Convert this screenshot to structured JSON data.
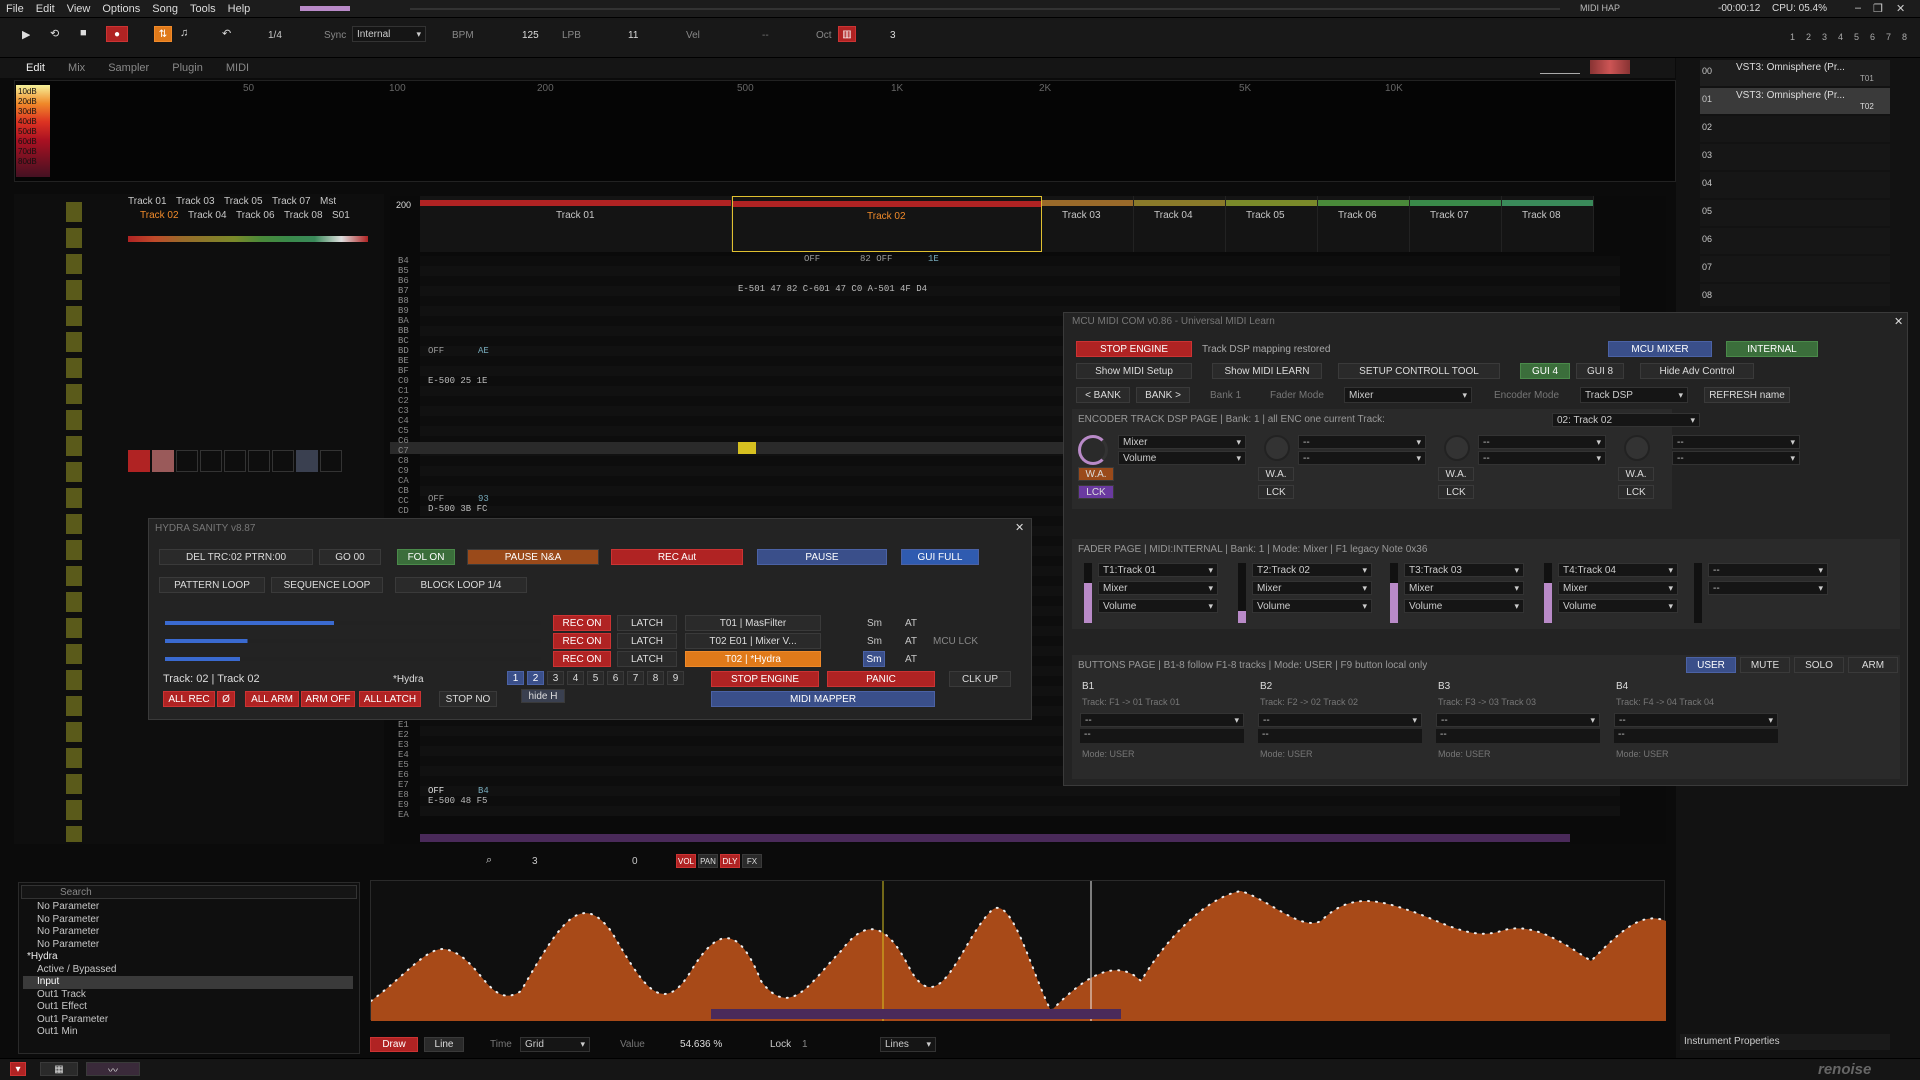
{
  "menu": [
    "File",
    "Edit",
    "View",
    "Options",
    "Song",
    "Tools",
    "Help"
  ],
  "status": {
    "midi": "MIDI HAP",
    "time": "-00:00:12",
    "cpu": "CPU: 05.4%"
  },
  "transport": {
    "step": "1/4",
    "sync_label": "Sync",
    "sync_value": "Internal",
    "bpm_label": "BPM",
    "bpm": "125",
    "lpb_label": "LPB",
    "lpb": "11",
    "vel_label": "Vel",
    "vel_value": "--",
    "oct_label": "Oct",
    "oct": "3",
    "track_nums": [
      "1",
      "2",
      "3",
      "4",
      "5",
      "6",
      "7",
      "8"
    ]
  },
  "tabs": [
    "Edit",
    "Mix",
    "Sampler",
    "Plugin",
    "MIDI"
  ],
  "spectrum": {
    "freqs": [
      "50",
      "100",
      "200",
      "500",
      "1K",
      "2K",
      "5K",
      "10K"
    ],
    "scale": [
      "10dB",
      "20dB",
      "30dB",
      "40dB",
      "50dB",
      "60dB",
      "70dB",
      "80dB"
    ]
  },
  "instruments": {
    "rows": [
      {
        "num": "00",
        "name": "VST3: Omnisphere (Pr...",
        "tag": "T01"
      },
      {
        "num": "01",
        "name": "VST3: Omnisphere (Pr...",
        "tag": "T02"
      },
      {
        "num": "02"
      },
      {
        "num": "03"
      },
      {
        "num": "04"
      },
      {
        "num": "05"
      },
      {
        "num": "06"
      },
      {
        "num": "07"
      },
      {
        "num": "08"
      }
    ]
  },
  "mixer_tracks": {
    "row1": [
      "Track 01",
      "Track 03",
      "Track 05",
      "Track 07",
      "Mst"
    ],
    "row2": [
      "Track 02",
      "Track 04",
      "Track 06",
      "Track 08",
      "S01"
    ]
  },
  "pattern": {
    "num": "200",
    "tracks": [
      {
        "name": "Track 01",
        "color": "#b02323"
      },
      {
        "name": "Track 02",
        "color": "#b02323"
      },
      {
        "name": "Track 03",
        "color": "#9a6a2a"
      },
      {
        "name": "Track 04",
        "color": "#8a7a2a"
      },
      {
        "name": "Track 05",
        "color": "#7a8a2a"
      },
      {
        "name": "Track 06",
        "color": "#4a8a3a"
      },
      {
        "name": "Track 07",
        "color": "#3a8a4a"
      },
      {
        "name": "Track 08",
        "color": "#3a8a5a"
      }
    ],
    "notes_left": [
      "B4",
      "B5",
      "B6",
      "B7",
      "B8",
      "B9",
      "BA",
      "BB",
      "BC",
      "BD",
      "BE",
      "BF",
      "C0",
      "C1",
      "C2",
      "C3",
      "C4",
      "C5",
      "C6",
      "C7",
      "C8",
      "C9",
      "CA",
      "CB",
      "CC",
      "CD"
    ],
    "notes_bottom": [
      "E1",
      "E2",
      "E3",
      "E4",
      "E5",
      "E6",
      "E7",
      "E8",
      "E9",
      "EA"
    ],
    "cells": {
      "t1a": "OFF",
      "t1a2": "AE",
      "t1b": "E-500 25 1E",
      "t1c": "OFF",
      "t1c2": "93",
      "t1d": "D-500 3B FC",
      "t2a": "OFF",
      "t2a2": "82 OFF",
      "t2a3": "1E",
      "t2b": "E-501 47 82 C-601 47 C0 A-501 4F D4",
      "t1e": "OFF",
      "t1e2": "B4",
      "t1f": "E-500 48 F5"
    }
  },
  "hydra": {
    "title": "HYDRA SANITY v8.87",
    "del": "DEL TRC:02 PTRN:00",
    "go": "GO 00",
    "fol": "FOL ON",
    "pause_na": "PAUSE N&A",
    "rec_aut": "REC Aut",
    "pause": "PAUSE",
    "gui_full": "GUI FULL",
    "pattern_loop": "PATTERN LOOP",
    "sequence_loop": "SEQUENCE LOOP",
    "block_loop": "BLOCK LOOP 1/4",
    "rows": [
      {
        "rec": "REC ON",
        "latch": "LATCH",
        "name": "T01 | MasFilter",
        "sm": "Sm",
        "at": "AT",
        "extra": ""
      },
      {
        "rec": "REC ON",
        "latch": "LATCH",
        "name": "T02 E01 | Mixer V...",
        "sm": "Sm",
        "at": "AT",
        "extra": "MCU LCK"
      },
      {
        "rec": "REC ON",
        "latch": "LATCH",
        "name": "T02 | *Hydra",
        "sm": "Sm",
        "at": "AT",
        "extra": ""
      }
    ],
    "track": "Track: 02 | Track 02",
    "hydra": "*Hydra",
    "pages": [
      "1",
      "2",
      "3",
      "4",
      "5",
      "6",
      "7",
      "8",
      "9"
    ],
    "stop_engine": "STOP ENGINE",
    "panic": "PANIC",
    "clk_up": "CLK UP",
    "all_rec": "ALL REC",
    "phi": "Ø",
    "all_arm": "ALL ARM",
    "arm_off": "ARM OFF",
    "all_latch": "ALL LATCH",
    "stop_no": "STOP NO",
    "hide_h": "hide H",
    "midi_mapper": "MIDI MAPPER"
  },
  "mcu": {
    "title": "MCU MIDI COM v0.86 - Universal MIDI Learn",
    "stop_engine": "STOP ENGINE",
    "status": "Track DSP mapping restored",
    "mcu_mixer": "MCU MIXER",
    "internal": "INTERNAL",
    "show_midi_setup": "Show MIDI Setup",
    "show_midi_learn": "Show MIDI LEARN",
    "setup_tool": "SETUP CONTROLL TOOL",
    "gui4": "GUI 4",
    "gui8": "GUI 8",
    "hide_adv": "Hide Adv Control",
    "bank_prev": "< BANK",
    "bank_next": "BANK >",
    "bank": "Bank 1",
    "fader_mode_label": "Fader Mode",
    "fader_mode": "Mixer",
    "encoder_mode_label": "Encoder Mode",
    "encoder_mode": "Track DSP",
    "refresh": "REFRESH name",
    "encoder_title": "ENCODER TRACK DSP PAGE | Bank: 1 | all ENC one current Track:",
    "encoder_track": "02: Track 02",
    "enc": [
      {
        "a": "Mixer",
        "b": "Volume"
      },
      {
        "a": "--",
        "b": "--"
      },
      {
        "a": "--",
        "b": "--"
      },
      {
        "a": "--",
        "b": "--"
      }
    ],
    "wa": "W.A.",
    "lck": "LCK",
    "fader_title": "FADER PAGE | MIDI:INTERNAL | Bank: 1 | Mode: Mixer | F1 legacy Note 0x36",
    "faders": [
      {
        "t": "T1:Track 01",
        "a": "Mixer",
        "b": "Volume"
      },
      {
        "t": "T2:Track 02",
        "a": "Mixer",
        "b": "Volume"
      },
      {
        "t": "T3:Track 03",
        "a": "Mixer",
        "b": "Volume"
      },
      {
        "t": "T4:Track 04",
        "a": "Mixer",
        "b": "Volume"
      },
      {
        "t": "--",
        "a": "--",
        "b": ""
      }
    ],
    "buttons_title": "BUTTONS PAGE | B1-8 follow F1-8 tracks | Mode: USER | F9 button local only",
    "user": "USER",
    "mute": "MUTE",
    "solo": "SOLO",
    "arm": "ARM",
    "bbuttons": [
      {
        "b": "B1",
        "t": "Track: F1 -> 01 Track 01"
      },
      {
        "b": "B2",
        "t": "Track: F2 -> 02 Track 02"
      },
      {
        "b": "B3",
        "t": "Track: F3 -> 03 Track 03"
      },
      {
        "b": "B4",
        "t": "Track: F4 -> 04 Track 04"
      }
    ],
    "mode_user": "Mode: USER",
    "dash": "--"
  },
  "params": {
    "search": "Search",
    "items": [
      "No Parameter",
      "No Parameter",
      "No Parameter",
      "No Parameter",
      "*Hydra",
      "Active / Bypassed",
      "Input",
      "Out1 Track",
      "Out1 Effect",
      "Out1 Parameter",
      "Out1 Min"
    ]
  },
  "auto_toolbar": {
    "draw": "Draw",
    "line": "Line",
    "time": "Time",
    "grid": "Grid",
    "value": "Value",
    "value_num": "54.636 %",
    "lock": "Lock",
    "lock_val": "1",
    "lines": "Lines"
  },
  "pattern_toolbar": {
    "vol": "VOL",
    "pan": "PAN",
    "dly": "DLY",
    "fx": "FX",
    "num1": "3",
    "num2": "0"
  },
  "instrument_props": "Instrument Properties",
  "brand": "renoise"
}
